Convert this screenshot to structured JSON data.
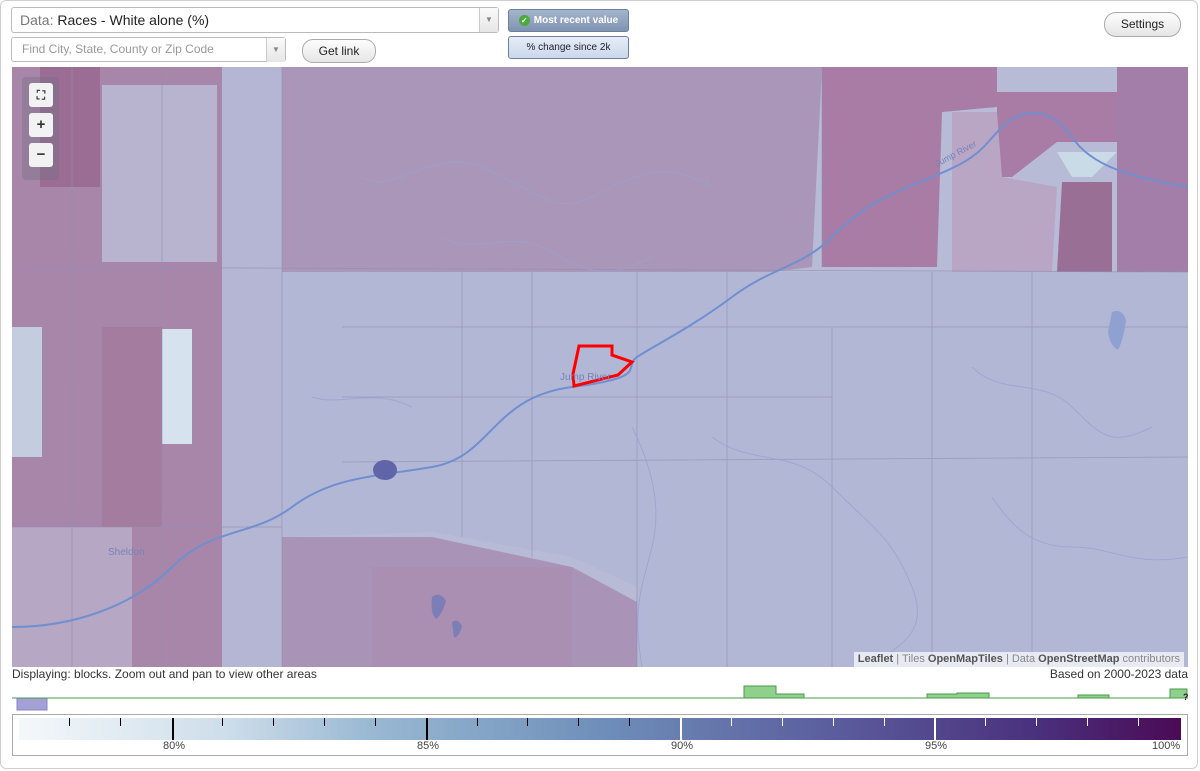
{
  "data_select": {
    "label": "Data:",
    "value": "Races - White alone (%)"
  },
  "search": {
    "placeholder": "Find City, State, County or Zip Code",
    "value": ""
  },
  "buttons": {
    "get_link": "Get link",
    "most_recent": "Most recent value",
    "pct_change": "% change since 2k",
    "settings": "Settings"
  },
  "zoom": {
    "fullscreen": "fullscreen-icon",
    "zoom_in": "+",
    "zoom_out": "−"
  },
  "map_labels": {
    "town_center": "Jump River",
    "town_west": "Sheldon",
    "river": "Jump River"
  },
  "attribution": {
    "leaflet": "Leaflet",
    "tiles_prefix": "| Tiles",
    "tiles": "OpenMapTiles",
    "data_prefix": "| Data",
    "data": "OpenStreetMap",
    "suffix": "contributors"
  },
  "display_note": "Displaying: blocks. Zoom out and pan to view other areas",
  "based_on": "Based on 2000-2023 data",
  "histogram": {
    "unknown_label": "?"
  },
  "legend": {
    "labels": [
      "80%",
      "85%",
      "90%",
      "95%",
      "100%"
    ]
  },
  "colors": {
    "highlight": "#ff0000",
    "low": "#f4f8fb",
    "high": "#4b0a55",
    "histogram": "#8fd08c"
  }
}
